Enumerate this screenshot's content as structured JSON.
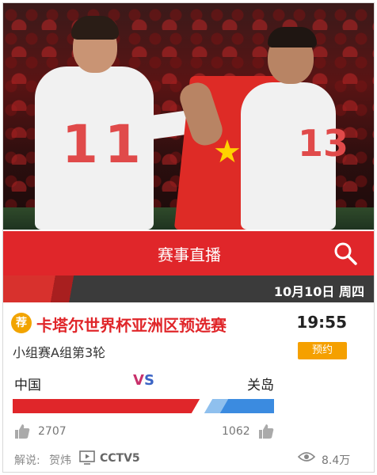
{
  "hero": {
    "jersey_left": "11",
    "jersey_right": "13"
  },
  "header": {
    "title": "赛事直播",
    "search_icon": "search-icon"
  },
  "date_strip": {
    "date": "10月10日 周四"
  },
  "match": {
    "recommend_badge": "荐",
    "title": "卡塔尔世界杯亚洲区预选赛",
    "time": "19:55",
    "round": "小组赛A组第3轮",
    "reserve_label": "预约",
    "home_team": "中国",
    "away_team": "关岛",
    "vs_v": "V",
    "vs_s": "S",
    "home_likes": "2707",
    "away_likes": "1062",
    "home_support_fraction": 0.718,
    "commentary_label": "解说:",
    "commentator": "贺炜",
    "channel": "CCTV5",
    "views": "8.4万"
  },
  "colors": {
    "accent_red": "#e0262a",
    "reserve_orange": "#f5a000",
    "away_blue": "#3b8be0"
  }
}
